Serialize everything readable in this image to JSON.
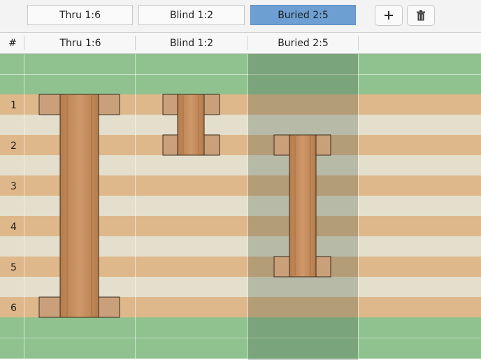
{
  "toolbar": {
    "tabs": [
      {
        "label": "Thru 1:6",
        "active": false
      },
      {
        "label": "Blind 1:2",
        "active": false
      },
      {
        "label": "Buried 2:5",
        "active": true
      }
    ],
    "add_icon": "plus-icon",
    "delete_icon": "trash-icon"
  },
  "grid": {
    "columns": [
      {
        "label": "#"
      },
      {
        "label": "Thru 1:6"
      },
      {
        "label": "Blind 1:2"
      },
      {
        "label": "Buried 2:5"
      }
    ],
    "layer_numbers": [
      "1",
      "2",
      "3",
      "4",
      "5",
      "6"
    ],
    "selected_column": "Buried 2:5"
  },
  "colors": {
    "selected_tab": "#6d9fd2",
    "surface_layer": "#8fc28f",
    "copper_layer": "#deb88a",
    "dielectric_layer": "#e3dfcc",
    "via_barrel": "#c38c5a",
    "via_pad": "#c9a07a"
  }
}
